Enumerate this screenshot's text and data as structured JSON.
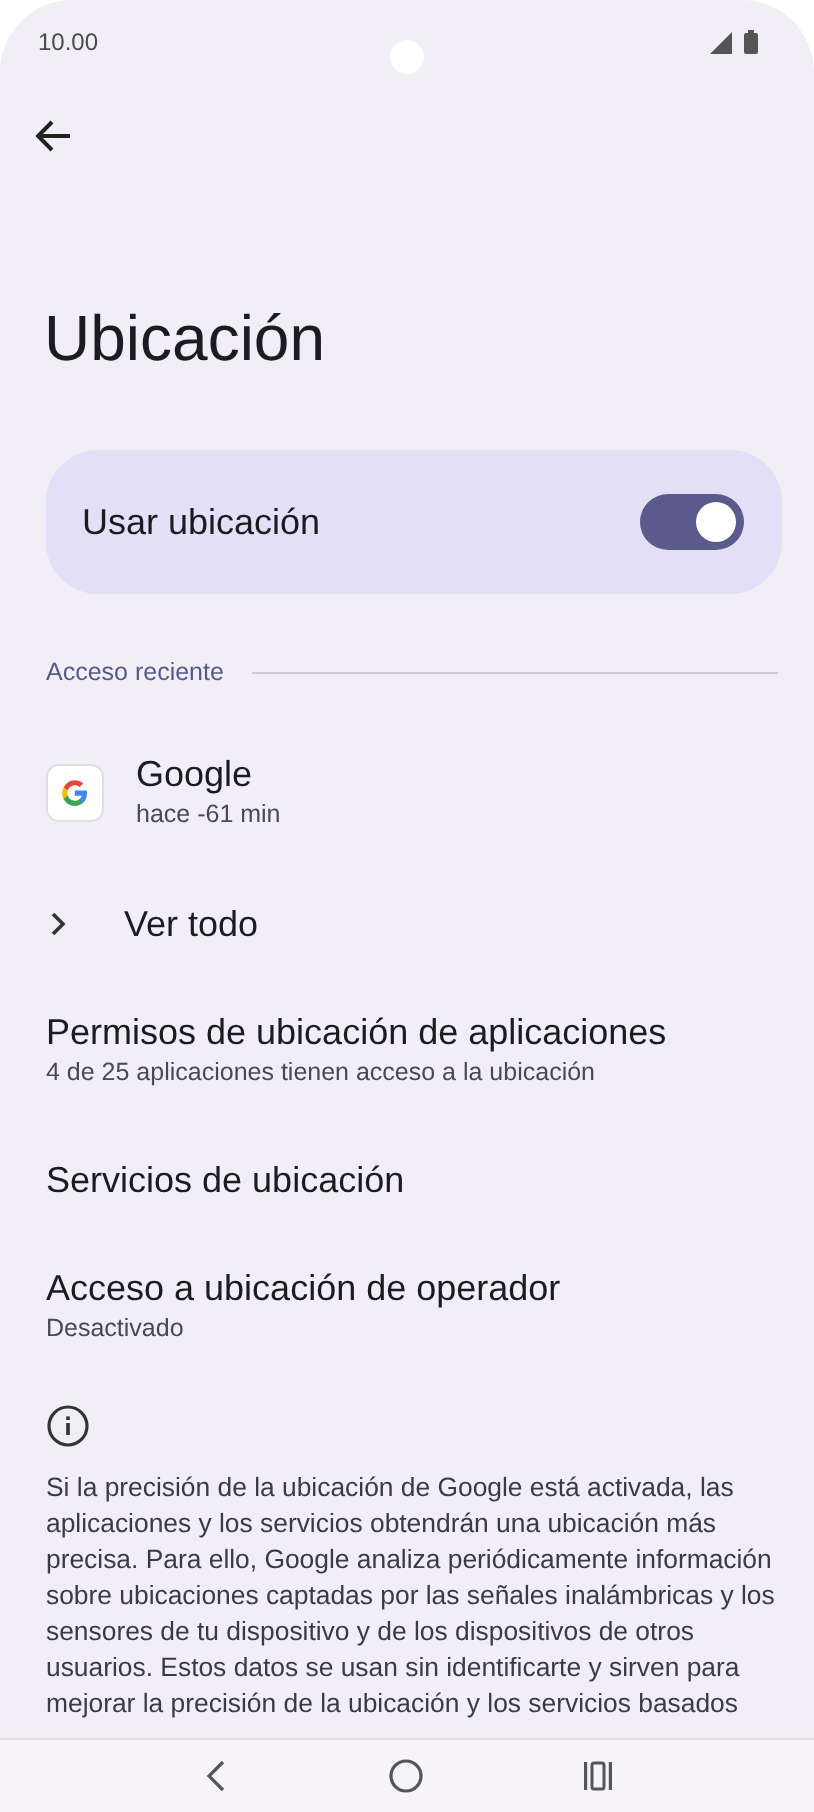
{
  "status_bar": {
    "time": "10.00"
  },
  "title": "Ubicación",
  "main_toggle": {
    "label": "Usar ubicación",
    "on": true
  },
  "section": {
    "title": "Acceso reciente"
  },
  "recent_apps": [
    {
      "name": "Google",
      "time": "hace -61 min"
    }
  ],
  "see_all": {
    "label": "Ver todo"
  },
  "settings": [
    {
      "title": "Permisos de ubicación de aplicaciones",
      "subtitle": "4 de 25 aplicaciones tienen acceso a la ubicación"
    },
    {
      "title": "Servicios de ubicación"
    },
    {
      "title": "Acceso a ubicación de operador",
      "subtitle": "Desactivado"
    }
  ],
  "info_text": "Si la precisión de la ubicación de Google está activada, las aplicaciones y los servicios obtendrán una ubicación más precisa. Para ello, Google analiza periódicamente información sobre ubicaciones captadas por las señales inalámbricas y los sensores de tu dispositivo y de los dispositivos de otros usuarios. Estos datos se usan sin identificarte y sirven para mejorar la precisión de la ubicación y los servicios basados"
}
